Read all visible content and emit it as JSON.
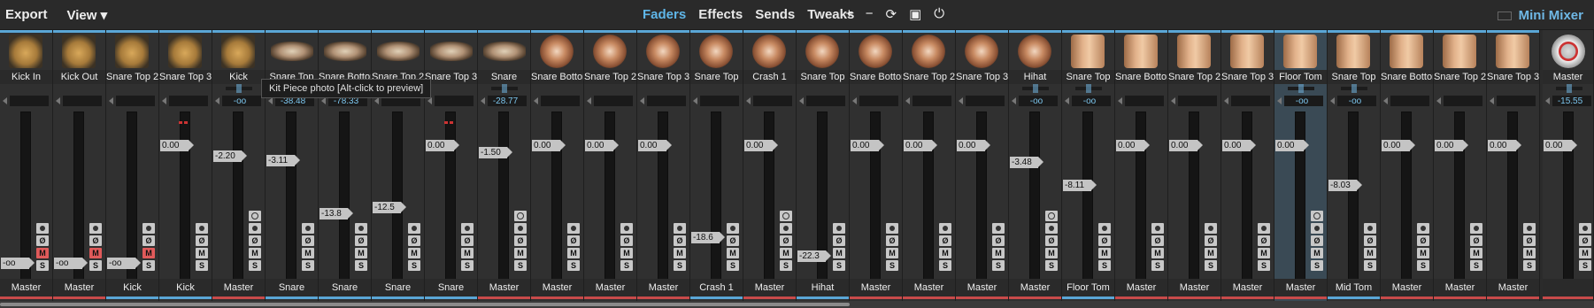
{
  "menu": {
    "export": "Export",
    "view": "View ▾"
  },
  "tabs": [
    {
      "label": "Faders",
      "active": true
    },
    {
      "label": "Effects",
      "active": false
    },
    {
      "label": "Sends",
      "active": false
    },
    {
      "label": "Tweaks",
      "active": false
    }
  ],
  "toolbar_icons": [
    "plus-icon",
    "minus-icon",
    "refresh-icon",
    "panel-icon",
    "power-icon"
  ],
  "toolbar_glyphs": [
    "+",
    "−",
    "⟳",
    "▣",
    "⏻"
  ],
  "mini_mixer": "Mini Mixer",
  "tooltip": "Kit Piece photo [Alt-click to preview]",
  "colors": {
    "accent": "#5fb6e8",
    "blue_line": "#5aa6d6",
    "red_line": "#c84a4a",
    "mute_on": "#e05a5a"
  },
  "strips": [
    {
      "name": "Kick In",
      "type": "kick",
      "peak": "",
      "fader": "-oo",
      "route": "Master",
      "route_color": "red",
      "mute_on": true,
      "top": "blue",
      "small_fader": true
    },
    {
      "name": "Kick Out",
      "type": "kick",
      "peak": "",
      "fader": "-oo",
      "route": "Master",
      "route_color": "red",
      "mute_on": true,
      "top": "blue",
      "small_fader": true
    },
    {
      "name": "Snare Top 2",
      "type": "kick",
      "peak": "",
      "fader": "-oo",
      "route": "Kick",
      "route_color": "blue",
      "mute_on": true,
      "top": "blue",
      "small_fader": true
    },
    {
      "name": "Snare Top 3",
      "type": "kick",
      "peak": "",
      "fader": "0.00",
      "route": "Kick",
      "route_color": "blue",
      "mute_on": false,
      "top": "blue"
    },
    {
      "name": "Kick",
      "type": "kick",
      "peak": "-oo",
      "fader": "-2.20",
      "route": "Master",
      "route_color": "red",
      "mute_on": false,
      "top": "blue",
      "ring": true
    },
    {
      "name": "Snare Top",
      "type": "snare",
      "peak": "-38.48",
      "fader": "-3.11",
      "route": "Snare",
      "route_color": "blue",
      "mute_on": false,
      "top": "blue"
    },
    {
      "name": "Snare Bottom",
      "type": "snare",
      "peak": "-78.33",
      "fader": "-13.8",
      "route": "Snare",
      "route_color": "blue",
      "mute_on": false,
      "top": "blue"
    },
    {
      "name": "Snare Top 2",
      "type": "snare",
      "peak": "",
      "fader": "-12.5",
      "route": "Snare",
      "route_color": "blue",
      "mute_on": false,
      "top": "blue"
    },
    {
      "name": "Snare Top 3",
      "type": "snare",
      "peak": "",
      "fader": "0.00",
      "route": "Snare",
      "route_color": "blue",
      "mute_on": false,
      "top": "blue"
    },
    {
      "name": "Snare",
      "type": "snare",
      "peak": "-28.77",
      "fader": "-1.50",
      "route": "Master",
      "route_color": "red",
      "mute_on": false,
      "top": "blue",
      "ring": true
    },
    {
      "name": "Snare Bottom",
      "type": "cymbal",
      "peak": "",
      "fader": "0.00",
      "route": "Master",
      "route_color": "red",
      "mute_on": false,
      "top": "blue"
    },
    {
      "name": "Snare Top 2",
      "type": "cymbal",
      "peak": "",
      "fader": "0.00",
      "route": "Master",
      "route_color": "red",
      "mute_on": false,
      "top": "blue"
    },
    {
      "name": "Snare Top 3",
      "type": "cymbal",
      "peak": "",
      "fader": "0.00",
      "route": "Master",
      "route_color": "red",
      "mute_on": false,
      "top": "blue"
    },
    {
      "name": "Snare Top",
      "type": "cymbal",
      "peak": "",
      "fader": "-18.6",
      "route": "Crash 1",
      "route_color": "blue",
      "mute_on": false,
      "top": "blue"
    },
    {
      "name": "Crash 1",
      "type": "cymbal",
      "peak": "",
      "fader": "0.00",
      "route": "Master",
      "route_color": "red",
      "mute_on": false,
      "top": "blue",
      "ring": true
    },
    {
      "name": "Snare Top",
      "type": "cymbal",
      "peak": "",
      "fader": "-22.3",
      "route": "Hihat",
      "route_color": "blue",
      "mute_on": false,
      "top": "blue"
    },
    {
      "name": "Snare Bottom",
      "type": "cymbal",
      "peak": "",
      "fader": "0.00",
      "route": "Master",
      "route_color": "red",
      "mute_on": false,
      "top": "blue"
    },
    {
      "name": "Snare Top 2",
      "type": "cymbal",
      "peak": "",
      "fader": "0.00",
      "route": "Master",
      "route_color": "red",
      "mute_on": false,
      "top": "blue"
    },
    {
      "name": "Snare Top 3",
      "type": "cymbal",
      "peak": "",
      "fader": "0.00",
      "route": "Master",
      "route_color": "red",
      "mute_on": false,
      "top": "blue"
    },
    {
      "name": "Hihat",
      "type": "cymbal",
      "peak": "-oo",
      "fader": "-3.48",
      "route": "Master",
      "route_color": "red",
      "mute_on": false,
      "top": "blue",
      "ring": true
    },
    {
      "name": "Snare Top",
      "type": "tom",
      "peak": "-oo",
      "fader": "-8.11",
      "route": "Floor Tom",
      "route_color": "blue",
      "mute_on": false,
      "top": "blue"
    },
    {
      "name": "Snare Bottom",
      "type": "tom",
      "peak": "",
      "fader": "0.00",
      "route": "Master",
      "route_color": "red",
      "mute_on": false,
      "top": "blue"
    },
    {
      "name": "Snare Top 2",
      "type": "tom",
      "peak": "",
      "fader": "0.00",
      "route": "Master",
      "route_color": "red",
      "mute_on": false,
      "top": "blue"
    },
    {
      "name": "Snare Top 3",
      "type": "tom",
      "peak": "",
      "fader": "0.00",
      "route": "Master",
      "route_color": "red",
      "mute_on": false,
      "top": "blue"
    },
    {
      "name": "Floor Tom",
      "type": "tom",
      "peak": "-oo",
      "fader": "0.00",
      "route": "Master",
      "route_color": "red",
      "mute_on": false,
      "top": "blue",
      "ring": true,
      "selected": true
    },
    {
      "name": "Snare Top",
      "type": "tom",
      "peak": "-oo",
      "fader": "-8.03",
      "route": "Mid Tom",
      "route_color": "blue",
      "mute_on": false,
      "top": "blue"
    },
    {
      "name": "Snare Bottom",
      "type": "tom",
      "peak": "",
      "fader": "0.00",
      "route": "Master",
      "route_color": "red",
      "mute_on": false,
      "top": "blue"
    },
    {
      "name": "Snare Top 2",
      "type": "tom",
      "peak": "",
      "fader": "0.00",
      "route": "Master",
      "route_color": "red",
      "mute_on": false,
      "top": "blue"
    },
    {
      "name": "Snare Top 3",
      "type": "tom",
      "peak": "",
      "fader": "0.00",
      "route": "Master",
      "route_color": "red",
      "mute_on": false,
      "top": "blue"
    },
    {
      "name": "Master",
      "type": "master",
      "peak": "-15.55",
      "fader": "0.00",
      "route": "",
      "route_color": "red",
      "mute_on": false,
      "top": "none",
      "master": true
    }
  ]
}
